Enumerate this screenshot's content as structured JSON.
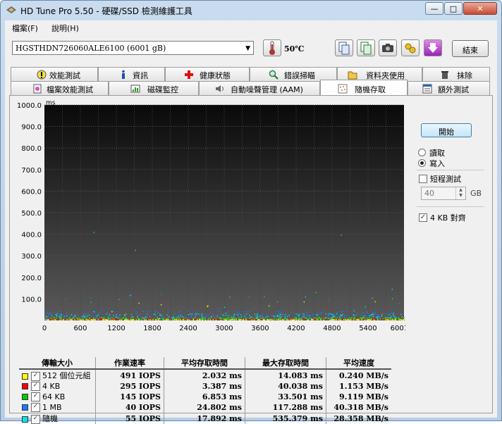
{
  "window": {
    "title": "HD Tune Pro 5.50 - 硬碟/SSD 檢測維護工具",
    "minimize": "—",
    "maximize": "□",
    "close": "✕"
  },
  "menu": [
    {
      "label": "檔案(F)"
    },
    {
      "label": "說明(H)"
    }
  ],
  "toolbar": {
    "drive": "HGSTHDN726060ALE6100 (6001 gB)",
    "temperature": "50℃",
    "exit_label": "結束"
  },
  "tabs_top": [
    {
      "label": "效能測試",
      "icon": "info-exclaim-icon"
    },
    {
      "label": "資訊",
      "icon": "info-icon"
    },
    {
      "label": "健康狀態",
      "icon": "red-cross-icon"
    },
    {
      "label": "錯誤掃瞄",
      "icon": "magnifier-icon"
    },
    {
      "label": "資料夾使用",
      "icon": "folder-icon"
    },
    {
      "label": "抹除",
      "icon": "trash-icon"
    }
  ],
  "tabs_bottom": [
    {
      "label": "檔案效能測試",
      "icon": "file-benchmark-icon"
    },
    {
      "label": "磁碟監控",
      "icon": "disk-monitor-icon"
    },
    {
      "label": "自動噪聲管理 (AAM)",
      "icon": "speaker-icon"
    },
    {
      "label": "隨機存取",
      "icon": "random-access-icon",
      "active": true
    },
    {
      "label": "額外測試",
      "icon": "extra-tests-icon"
    }
  ],
  "side": {
    "start_label": "開始",
    "read_label": "讀取",
    "write_label": "寫入",
    "mode_selected": "寫入",
    "short_test_label": "短程測試",
    "short_test_checked": false,
    "short_test_value": "40",
    "short_test_unit": "GB",
    "align_label": "4 KB 對齊",
    "align_checked": true
  },
  "chart_data": {
    "type": "scatter",
    "ylabel": "ms",
    "xlabel": "",
    "ylim": [
      0,
      1000
    ],
    "xlim": [
      0,
      6001
    ],
    "y_ticks": [
      "1000.0",
      "900.0",
      "800.0",
      "700.0",
      "600.0",
      "500.0",
      "400.0",
      "300.0",
      "200.0",
      "100.0"
    ],
    "x_ticks": [
      "0",
      "600",
      "1200",
      "1800",
      "2400",
      "3000",
      "3600",
      "4200",
      "4800",
      "5400",
      "6001gB"
    ],
    "grid": true,
    "series": [
      {
        "name": "512 個位元組",
        "color": "#ffff00",
        "typical_ms": 2.0
      },
      {
        "name": "4 KB",
        "color": "#ff0000",
        "typical_ms": 3.4
      },
      {
        "name": "64 KB",
        "color": "#00ff00",
        "typical_ms": 6.9
      },
      {
        "name": "1 MB",
        "color": "#1e78ff",
        "typical_ms": 24.8
      },
      {
        "name": "隨機",
        "color": "#00e6e6",
        "typical_ms": 17.9
      }
    ]
  },
  "results": {
    "headers": [
      "傳輸大小",
      "作業速率",
      "平均存取時間",
      "最大存取時間",
      "平均速度"
    ],
    "rows": [
      {
        "label": "512 個位元組",
        "color": "#ffff00",
        "checked": "✓",
        "iops": "491 IOPS",
        "avg": "2.032 ms",
        "max": "14.083 ms",
        "speed": "0.240 MB/s"
      },
      {
        "label": "4 KB",
        "color": "#ff0000",
        "checked": "✓",
        "iops": "295 IOPS",
        "avg": "3.387 ms",
        "max": "40.038 ms",
        "speed": "1.153 MB/s"
      },
      {
        "label": "64 KB",
        "color": "#00cc00",
        "checked": "✓",
        "iops": "145 IOPS",
        "avg": "6.853 ms",
        "max": "33.501 ms",
        "speed": "9.119 MB/s"
      },
      {
        "label": "1 MB",
        "color": "#1e78ff",
        "checked": "✓",
        "iops": "40 IOPS",
        "avg": "24.802 ms",
        "max": "117.288 ms",
        "speed": "40.318 MB/s"
      },
      {
        "label": "隨機",
        "color": "#00e6e6",
        "checked": "✓",
        "iops": "55 IOPS",
        "avg": "17.892 ms",
        "max": "535.379 ms",
        "speed": "28.358 MB/s"
      }
    ]
  }
}
